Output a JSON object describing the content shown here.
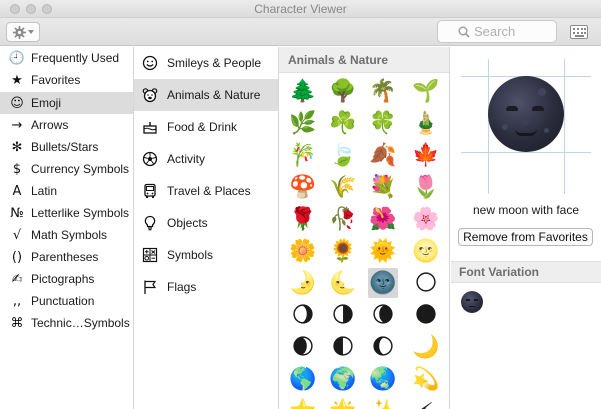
{
  "window": {
    "title": "Character Viewer"
  },
  "toolbar": {
    "search_placeholder": "Search",
    "action_icon": "gear-icon",
    "keyboard_icon": "keyboard-viewer-icon"
  },
  "sidebar": {
    "items": [
      {
        "label": "Frequently Used",
        "icon": "clock-icon",
        "glyph": "🕘"
      },
      {
        "label": "Favorites",
        "icon": "star-icon",
        "glyph": "★"
      },
      {
        "label": "Emoji",
        "icon": "smiley-icon",
        "glyph": "☺",
        "selected": true
      },
      {
        "label": "Arrows",
        "icon": "arrow-icon",
        "glyph": "→"
      },
      {
        "label": "Bullets/Stars",
        "icon": "asterisk-icon",
        "glyph": "✻"
      },
      {
        "label": "Currency Symbols",
        "icon": "dollar-icon",
        "glyph": "$"
      },
      {
        "label": "Latin",
        "icon": "letter-a-icon",
        "glyph": "A"
      },
      {
        "label": "Letterlike Symbols",
        "icon": "numero-icon",
        "glyph": "№"
      },
      {
        "label": "Math Symbols",
        "icon": "square-root-icon",
        "glyph": "√"
      },
      {
        "label": "Parentheses",
        "icon": "parentheses-icon",
        "glyph": "()"
      },
      {
        "label": "Pictographs",
        "icon": "pencil-icon",
        "glyph": "✍"
      },
      {
        "label": "Punctuation",
        "icon": "comma-icon",
        "glyph": ",,"
      },
      {
        "label": "Technic…Symbols",
        "icon": "command-icon",
        "glyph": "⌘"
      }
    ]
  },
  "categories": {
    "items": [
      {
        "label": "Smileys & People",
        "icon": "smiley-face-icon"
      },
      {
        "label": "Animals & Nature",
        "icon": "bear-face-icon",
        "selected": true
      },
      {
        "label": "Food & Drink",
        "icon": "cake-icon"
      },
      {
        "label": "Activity",
        "icon": "soccer-ball-icon"
      },
      {
        "label": "Travel & Places",
        "icon": "bus-icon"
      },
      {
        "label": "Objects",
        "icon": "lightbulb-icon"
      },
      {
        "label": "Symbols",
        "icon": "symbols-icon"
      },
      {
        "label": "Flags",
        "icon": "flag-icon"
      }
    ]
  },
  "grid": {
    "header": "Animals & Nature",
    "rows": [
      [
        "🌲",
        "🌳",
        "🌴",
        "🌱"
      ],
      [
        "🌿",
        "☘️",
        "🍀",
        "🎍"
      ],
      [
        "🎋",
        "🍃",
        "🍂",
        "🍁"
      ],
      [
        "🍄",
        "🌾",
        "💐",
        "🌷"
      ],
      [
        "🌹",
        "🥀",
        "🌺",
        "🌸"
      ],
      [
        "🌼",
        "🌻",
        "🌞",
        "🌝"
      ],
      [
        "🌛",
        "🌜",
        "🌚",
        "🌕"
      ],
      [
        "🌖",
        "🌗",
        "🌘",
        "🌑"
      ],
      [
        "🌒",
        "🌓",
        "🌔",
        "🌙"
      ],
      [
        "🌎",
        "🌍",
        "🌏",
        "💫"
      ],
      [
        "⭐",
        "🌟",
        "✨",
        "⚡"
      ]
    ],
    "selected": {
      "row": 6,
      "col": 2
    }
  },
  "detail": {
    "character": "🌚",
    "character_name": "new moon with face",
    "remove_label": "Remove from Favorites",
    "font_variation_header": "Font Variation",
    "variants": [
      "🌚"
    ]
  },
  "colors": {
    "selection_bg": "#dcdcdc",
    "section_header_bg": "#eeeeee",
    "guide_lines": "#bcd4ee"
  }
}
